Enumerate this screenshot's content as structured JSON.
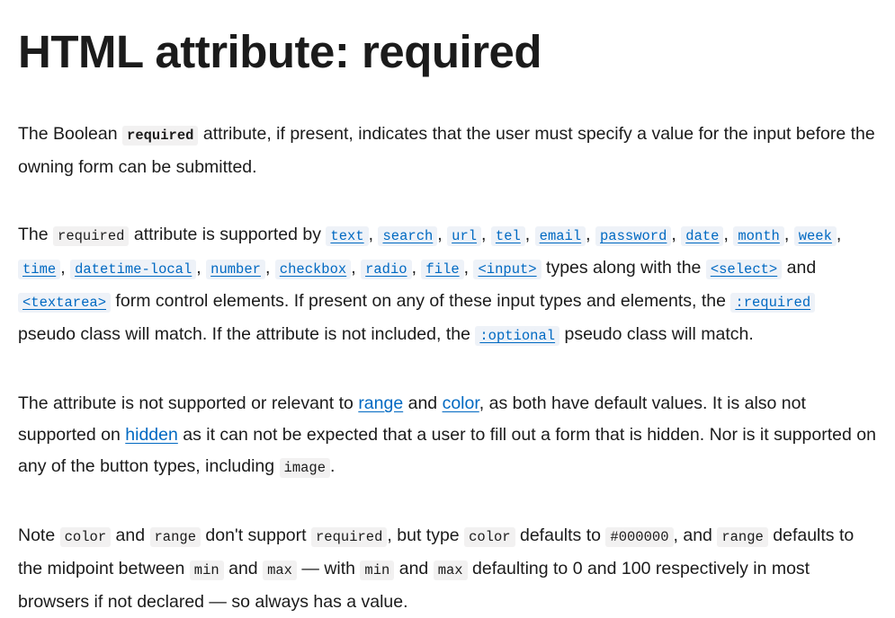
{
  "title": "HTML attribute: required",
  "p1": {
    "t1": "The Boolean ",
    "c1": "required",
    "t2": " attribute, if present, indicates that the user must specify a value for the input before the owning form can be submitted."
  },
  "p2": {
    "t1": "The ",
    "c1": "required",
    "t2": " attribute is supported by ",
    "types": [
      "text",
      "search",
      "url",
      "tel",
      "email",
      "password",
      "date",
      "month",
      "week",
      "time",
      "datetime-local",
      "number",
      "checkbox",
      "radio",
      "file"
    ],
    "sep": ", ",
    "input_link": "<input>",
    "t3": " types along with the ",
    "select_link": "<select>",
    "t4": " and ",
    "textarea_link": "<textarea>",
    "t5": " form control elements. If present on any of these input types and elements, the ",
    "required_link": ":required",
    "t6": " pseudo class will match. If the attribute is not included, the ",
    "optional_link": ":optional",
    "t7": " pseudo class will match."
  },
  "p3": {
    "t1": "The attribute is not supported or relevant to ",
    "range_link": "range",
    "t2": " and ",
    "color_link": "color",
    "t3": ", as both have default values. It is also not supported on ",
    "hidden_link": "hidden",
    "t4": " as it can not be expected that a user to fill out a form that is hidden. Nor is it supported on any of the button types, including ",
    "c1": "image",
    "t5": "."
  },
  "p4": {
    "t1": "Note ",
    "c1": "color",
    "t2": " and ",
    "c2": "range",
    "t3": " don't support ",
    "c3": "required",
    "t4": ", but type ",
    "c4": "color",
    "t5": " defaults to ",
    "c5": "#000000",
    "t6": ", and ",
    "c6": "range",
    "t7": " defaults to the midpoint between ",
    "c7": "min",
    "t8": " and ",
    "c8": "max",
    "t9": " — with ",
    "c9": "min",
    "t10": " and ",
    "c10": "max",
    "t11": " defaulting to 0 and 100 respectively in most browsers if not declared — so always has a value."
  }
}
